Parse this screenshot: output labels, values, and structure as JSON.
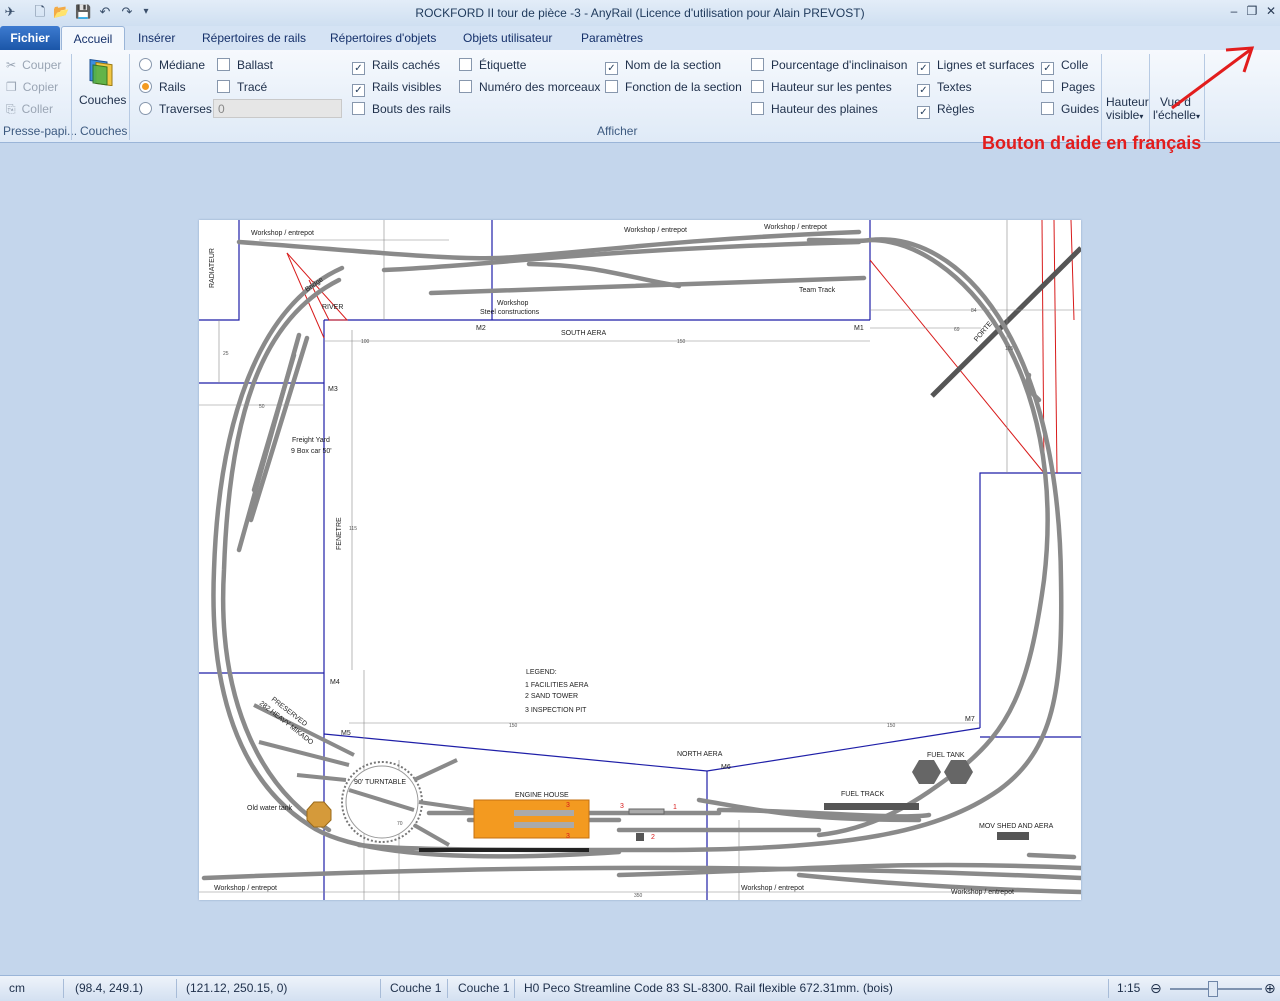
{
  "window": {
    "title": "ROCKFORD II tour de pièce -3 -  AnyRail (Licence d'utilisation pour Alain PREVOST)"
  },
  "tabs": [
    {
      "label": "Fichier"
    },
    {
      "label": "Accueil"
    },
    {
      "label": "Insérer"
    },
    {
      "label": "Répertoires de rails"
    },
    {
      "label": "Répertoires d'objets"
    },
    {
      "label": "Objets utilisateur"
    },
    {
      "label": "Paramètres"
    }
  ],
  "ribbon": {
    "clipboard": {
      "cut": "Couper",
      "copy": "Copier",
      "paste": "Coller",
      "group": "Presse-papi..."
    },
    "layers": {
      "button": "Couches",
      "group": "Couches"
    },
    "show": {
      "group": "Afficher",
      "mediane": "Médiane",
      "rails": "Rails",
      "traverses": "Traverses",
      "ballast": "Ballast",
      "trace": "Tracé",
      "numfield": "0",
      "rails_caches": "Rails cachés",
      "rails_visibles": "Rails visibles",
      "bouts_rails": "Bouts des rails",
      "etiquette": "Étiquette",
      "numero_morceaux": "Numéro des morceaux",
      "nom_section": "Nom de la section",
      "fonction_section": "Fonction de la section",
      "pourcentage": "Pourcentage d'inclinaison",
      "hauteur_pentes": "Hauteur sur les pentes",
      "hauteur_plaines": "Hauteur des plaines",
      "lignes_surfaces": "Lignes et surfaces",
      "textes": "Textes",
      "regles": "Règles",
      "colle": "Colle",
      "pages": "Pages",
      "guides": "Guides",
      "hauteur_visible_1": "Hauteur",
      "hauteur_visible_2": "visible",
      "vue_echelle_1": "Vue d",
      "vue_echelle_2": "l'échelle"
    }
  },
  "annotation": "Bouton d'aide en français",
  "plan": {
    "labels": {
      "ws1": "Workshop / entrepot",
      "ws2": "Workshop / entrepot",
      "ws3": "Workshop / entrepot",
      "ws4": "Workshop / entrepot",
      "ws5": "Workshop / entrepot",
      "ws6": "Workshop / entrepot",
      "radiateur": "RADIATEUR",
      "bridge": "Bridge",
      "river": "RIVER",
      "workshop_steel_1": "Workshop",
      "workshop_steel_2": "Steel constructions",
      "team_track": "Team Track",
      "south_aera": "SOUTH AERA",
      "m1": "M1",
      "m2": "M2",
      "m3": "M3",
      "m4": "M4",
      "m5": "M5",
      "m6": "M6",
      "m7": "M7",
      "porte": "PORTE",
      "freight_1": "Freight Yard",
      "freight_2": "9 Box car 50'",
      "fenetre": "FENETRE",
      "legend_0": "LEGEND:",
      "legend_1": "1 FACILITIES AERA",
      "legend_2": "2 SAND TOWER",
      "legend_3": "3 INSPECTION PIT",
      "preserved_1": "PRESERVED",
      "preserved_2": "282 HEAVY MIKADO",
      "turntable": "90' TURNTABLE",
      "old_water": "Old water tank",
      "engine_house": "ENGINE HOUSE",
      "north_aera": "NORTH AERA",
      "fuel_tank": "FUEL TANK",
      "fuel_track": "FUEL TRACK",
      "mov_shed": "MOV SHED AND AERA",
      "n1": "1",
      "n2": "2",
      "n3a": "3",
      "n3b": "3",
      "n3c": "3",
      "d100": "100",
      "d150a": "150",
      "d150b": "150",
      "d150c": "150",
      "d350": "350",
      "d84": "84",
      "d69": "69",
      "d25": "25",
      "d50": "50",
      "d115": "115",
      "d105": "105",
      "d70": "70"
    }
  },
  "status": {
    "unit": "cm",
    "pos1": "(98.4, 249.1)",
    "pos2": "(121.12, 250.15, 0)",
    "layer1": "Couche 1",
    "layer2": "Couche 1",
    "info": "H0 Peco Streamline Code 83 SL-8300. Rail flexible 672.31mm. (bois)",
    "scale": "1:15"
  },
  "colors": {
    "accent": "#1b56a8",
    "annotation": "#e21d1d",
    "orange": "#f39a20",
    "blue_lines": "#1f1fa8"
  }
}
